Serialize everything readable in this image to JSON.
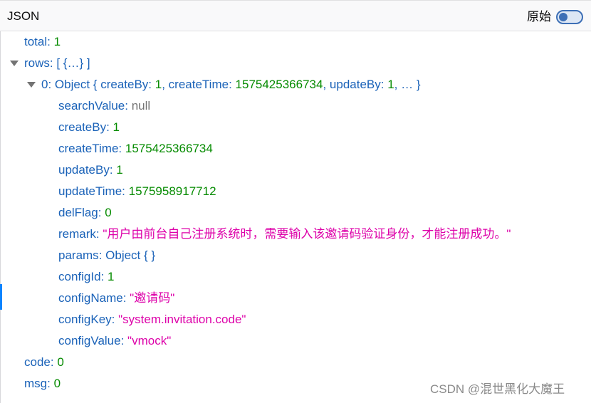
{
  "toolbar": {
    "tab_label": "JSON",
    "raw_label": "原始"
  },
  "tree": {
    "total": {
      "key": "total",
      "value": "1"
    },
    "rows": {
      "key": "rows",
      "preview": "[ {…} ]"
    },
    "row0": {
      "key": "0",
      "type": "Object",
      "preview_open": "{ ",
      "p1_key": "createBy",
      "p1_val": "1",
      "p2_key": "createTime",
      "p2_val": "1575425366734",
      "p3_key": "updateBy",
      "p3_val": "1",
      "preview_close": "… }"
    },
    "fields": {
      "searchValue": {
        "key": "searchValue",
        "value": "null"
      },
      "createBy": {
        "key": "createBy",
        "value": "1"
      },
      "createTime": {
        "key": "createTime",
        "value": "1575425366734"
      },
      "updateBy": {
        "key": "updateBy",
        "value": "1"
      },
      "updateTime": {
        "key": "updateTime",
        "value": "1575958917712"
      },
      "delFlag": {
        "key": "delFlag",
        "value": "0"
      },
      "remark": {
        "key": "remark",
        "value": "\"用户由前台自己注册系统时，需要输入该邀请码验证身份，才能注册成功。\""
      },
      "params": {
        "key": "params",
        "value": "Object { }"
      },
      "configId": {
        "key": "configId",
        "value": "1"
      },
      "configName": {
        "key": "configName",
        "value": "\"邀请码\""
      },
      "configKey": {
        "key": "configKey",
        "value": "\"system.invitation.code\""
      },
      "configValue": {
        "key": "configValue",
        "value": "\"vmock\""
      }
    },
    "code": {
      "key": "code",
      "value": "0"
    },
    "msg": {
      "key": "msg",
      "value": "0"
    }
  },
  "watermark": "CSDN @混世黑化大魔王",
  "colors": {
    "key": "#1a62b8",
    "number": "#058b00",
    "string": "#dd00a9",
    "null": "#737373",
    "toggle": "#3d6fb6"
  }
}
